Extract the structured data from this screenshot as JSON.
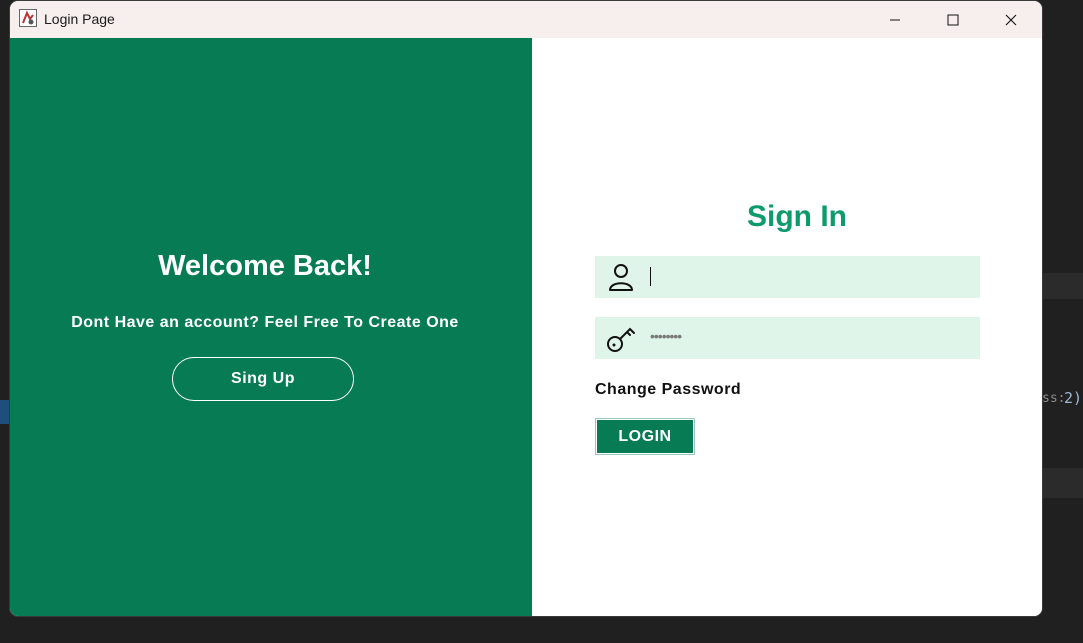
{
  "window": {
    "title": "Login Page",
    "controls": [
      "minimize-icon",
      "maximize-icon",
      "close-icon"
    ]
  },
  "left": {
    "welcome": "Welcome Back!",
    "subtitle": "Dont Have an account? Feel Free To Create One",
    "signup_label": "Sing Up"
  },
  "right": {
    "title": "Sign In",
    "username": {
      "value": "",
      "icon": "user-icon"
    },
    "password": {
      "masked": "••••••••",
      "icon": "key-icon"
    },
    "change_password": "Change Password",
    "login_label": "LOGIN"
  },
  "background": {
    "fragment": "ss:",
    "number": "2)"
  },
  "colors": {
    "left_panel": "#077b54",
    "signin_title": "#0e9b6c",
    "field_bg": "#dff5ea",
    "titlebar": "#f7eeee"
  }
}
